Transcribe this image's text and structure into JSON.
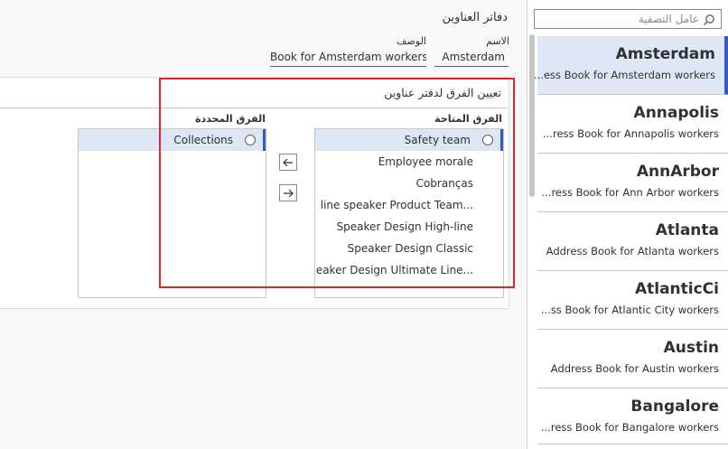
{
  "header": {
    "title": "دفاتر العناوين",
    "name_label": "الاسم",
    "name_value": "Amsterdam",
    "description_label": "الوصف",
    "description_value": "Book for Amsterdam workers..."
  },
  "filter": {
    "placeholder": "عامل التصفية"
  },
  "address_books": [
    {
      "title": "Amsterdam",
      "subtitle": "ess Book for Amsterdam workers...",
      "selected": true
    },
    {
      "title": "Annapolis",
      "subtitle": "ress Book for Annapolis workers...",
      "selected": false
    },
    {
      "title": "AnnArbor",
      "subtitle": "ress Book for Ann Arbor workers...",
      "selected": false
    },
    {
      "title": "Atlanta",
      "subtitle": "Address Book for Atlanta workers",
      "selected": false
    },
    {
      "title": "AtlanticCi",
      "subtitle": "ss Book for Atlantic City workers...",
      "selected": false
    },
    {
      "title": "Austin",
      "subtitle": "Address Book for Austin workers",
      "selected": false
    },
    {
      "title": "Bangalore",
      "subtitle": "ress Book for Bangalore workers...",
      "selected": false
    }
  ],
  "panel": {
    "title": "تعيين الفرق لدفتر عناوين",
    "available_label": "الفرق المتاحة",
    "selected_label": "الفرق المحددة",
    "available_teams": [
      "Safety team",
      "Employee morale",
      "Cobranças",
      "line speaker Product Team...",
      "Speaker Design High-line",
      "Speaker Design Classic",
      "eaker Design Ultimate Line..."
    ],
    "selected_teams": [
      "Collections"
    ]
  },
  "colors": {
    "accent": "#2f5cc6",
    "selected_bg": "#dfe7f7",
    "highlight": "#e0252b"
  }
}
